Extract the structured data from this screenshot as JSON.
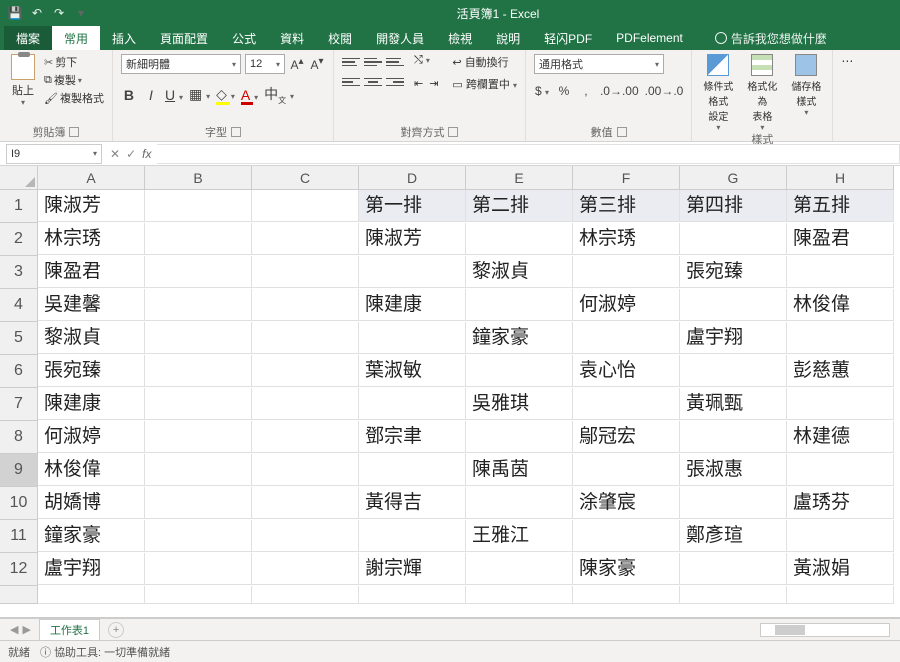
{
  "title": "活頁簿1 - Excel",
  "tabs": {
    "file": "檔案",
    "home": "常用",
    "insert": "插入",
    "layout": "頁面配置",
    "formulas": "公式",
    "data": "資料",
    "review": "校閱",
    "developer": "開發人員",
    "view": "檢視",
    "help": "說明",
    "qingpdf": "轻闪PDF",
    "pdfelement": "PDFelement",
    "tell": "告訴我您想做什麼"
  },
  "clipboard": {
    "paste": "貼上",
    "cut": "剪下",
    "copy": "複製",
    "fmt": "複製格式",
    "group": "剪貼簿"
  },
  "font": {
    "name": "新細明體",
    "size": "12",
    "group": "字型"
  },
  "align": {
    "wrap": "自動換行",
    "merge": "跨欄置中",
    "group": "對齊方式"
  },
  "number": {
    "format": "通用格式",
    "group": "數值"
  },
  "styles": {
    "cf": "條件式格式\n設定",
    "tbl": "格式化為\n表格",
    "cell": "儲存格\n樣式",
    "group": "樣式"
  },
  "namebox": "I9",
  "col_headers": [
    "A",
    "B",
    "C",
    "D",
    "E",
    "F",
    "G",
    "H"
  ],
  "grid": [
    [
      "陳淑芳",
      "",
      "",
      "第一排",
      "第二排",
      "第三排",
      "第四排",
      "第五排"
    ],
    [
      "林宗琇",
      "",
      "",
      "陳淑芳",
      "",
      "林宗琇",
      "",
      "陳盈君"
    ],
    [
      "陳盈君",
      "",
      "",
      "",
      "黎淑貞",
      "",
      "張宛臻",
      ""
    ],
    [
      "吳建馨",
      "",
      "",
      "陳建康",
      "",
      "何淑婷",
      "",
      "林俊偉"
    ],
    [
      "黎淑貞",
      "",
      "",
      "",
      "鐘家豪",
      "",
      "盧宇翔",
      ""
    ],
    [
      "張宛臻",
      "",
      "",
      "葉淑敏",
      "",
      "袁心怡",
      "",
      "彭慈蕙"
    ],
    [
      "陳建康",
      "",
      "",
      "",
      "吳雅琪",
      "",
      "黃珮甄",
      ""
    ],
    [
      "何淑婷",
      "",
      "",
      "鄧宗聿",
      "",
      "鄔冠宏",
      "",
      "林建德"
    ],
    [
      "林俊偉",
      "",
      "",
      "",
      "陳禹茵",
      "",
      "張淑惠",
      ""
    ],
    [
      "胡嬌博",
      "",
      "",
      "黃得吉",
      "",
      "涂肇宸",
      "",
      "盧琇芬"
    ],
    [
      "鐘家豪",
      "",
      "",
      "",
      "王雅江",
      "",
      "鄭彥瑄",
      ""
    ],
    [
      "盧宇翔",
      "",
      "",
      "謝宗輝",
      "",
      "陳家豪",
      "",
      "黃淑娟"
    ]
  ],
  "sheet": "工作表1",
  "status": {
    "ready": "就緒",
    "acc": "協助工具: 一切準備就緒"
  }
}
